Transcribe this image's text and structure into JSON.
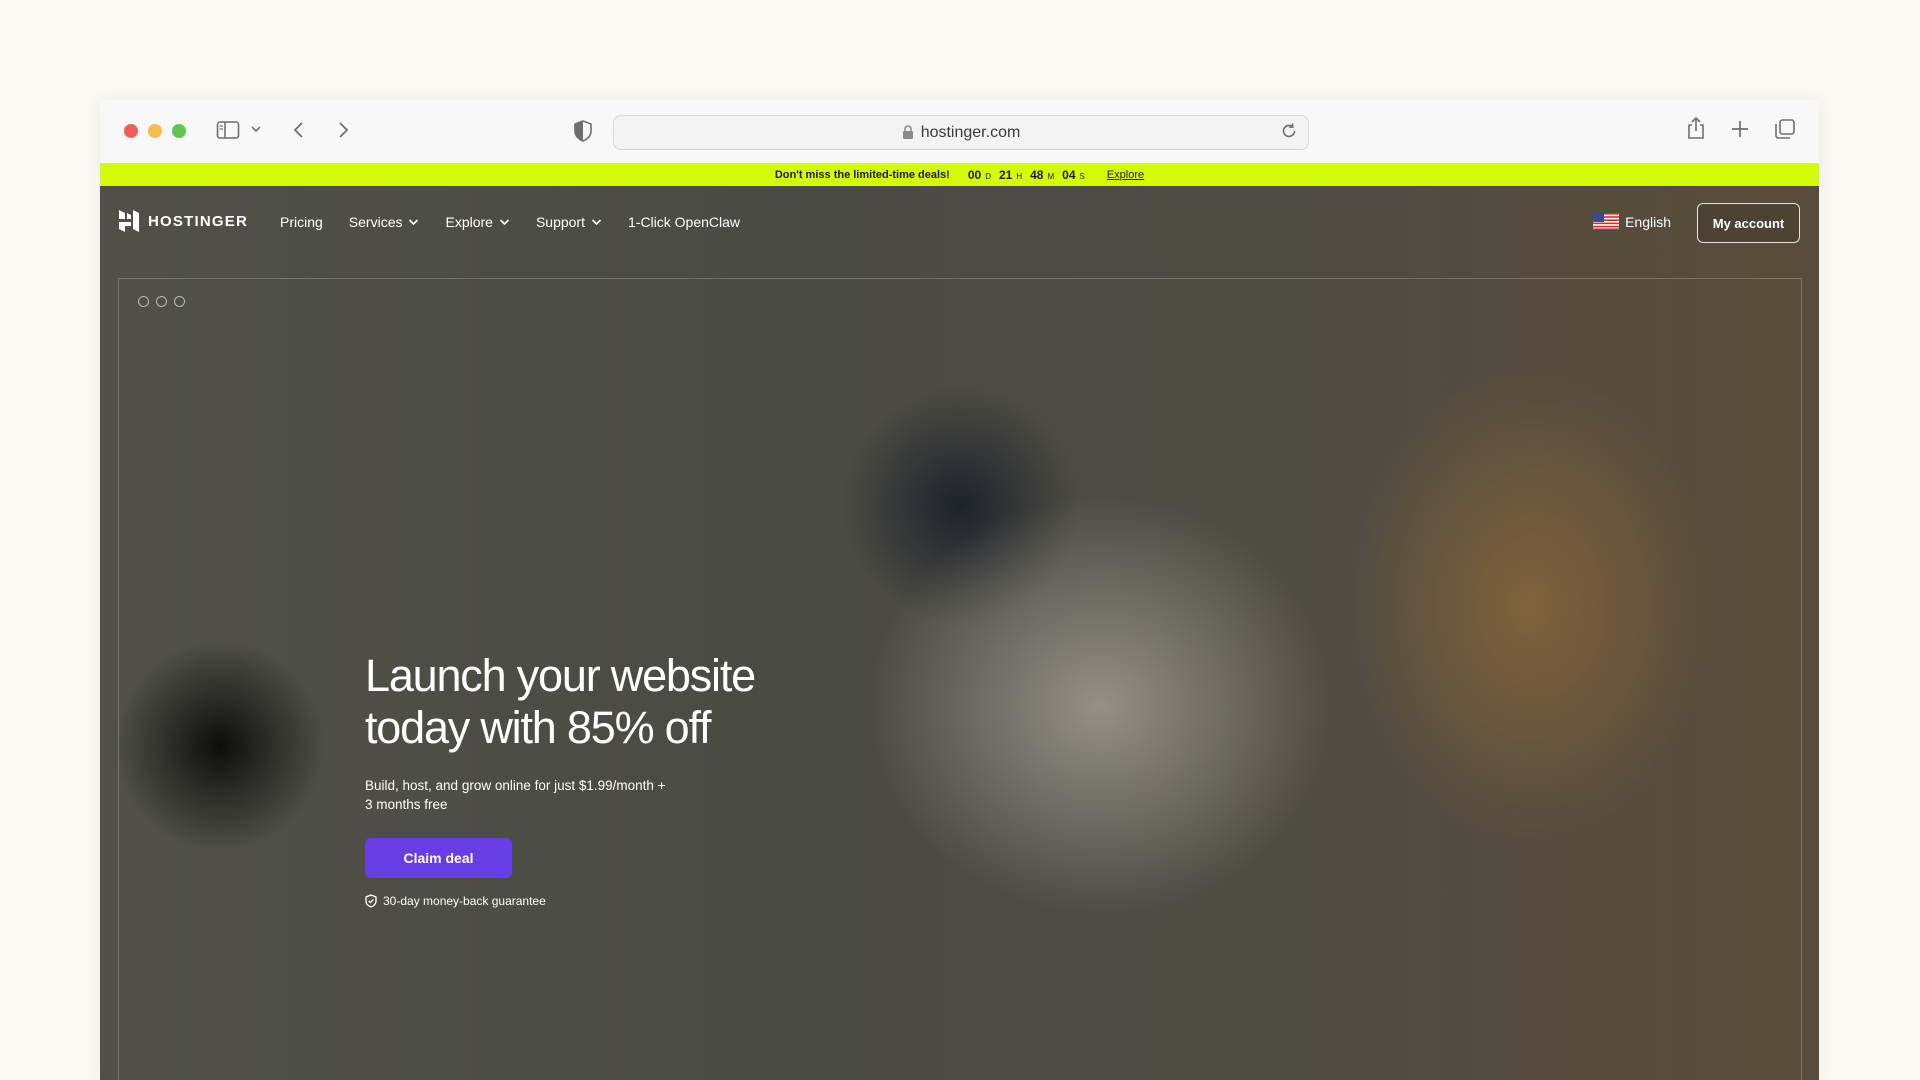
{
  "browser": {
    "url": "hostinger.com"
  },
  "promo": {
    "text": "Don't miss the limited-time deals!",
    "countdown": [
      {
        "value": "00",
        "unit": "D"
      },
      {
        "value": "21",
        "unit": "H"
      },
      {
        "value": "48",
        "unit": "M"
      },
      {
        "value": "04",
        "unit": "S"
      }
    ],
    "link": "Explore",
    "color": "#d4fb08"
  },
  "nav": {
    "brand": "HOSTINGER",
    "items": [
      {
        "label": "Pricing",
        "dropdown": false
      },
      {
        "label": "Services",
        "dropdown": true
      },
      {
        "label": "Explore",
        "dropdown": true
      },
      {
        "label": "Support",
        "dropdown": true
      },
      {
        "label": "1-Click OpenClaw",
        "dropdown": false
      }
    ],
    "language": "English",
    "language_flag": "us-flag-icon",
    "account": "My account"
  },
  "hero": {
    "headline_line1": "Launch your website",
    "headline_line2": "today with 85% off",
    "subtext_line1": "Build, host, and grow online for just $1.99/month +",
    "subtext_line2": "3 months free",
    "cta": "Claim deal",
    "cta_color": "#673de6",
    "guarantee": "30-day money-back guarantee"
  }
}
